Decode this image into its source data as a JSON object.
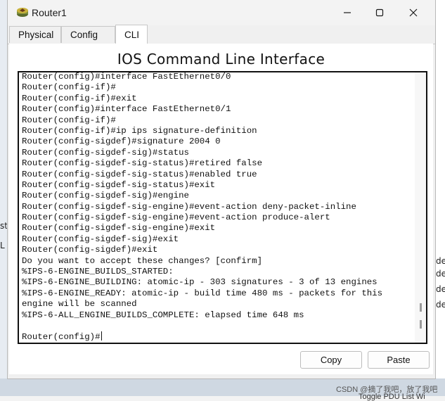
{
  "window": {
    "title": "Router1"
  },
  "tabs": [
    {
      "label": "Physical"
    },
    {
      "label": "Config"
    },
    {
      "label": "CLI"
    }
  ],
  "panel": {
    "heading": "IOS Command Line Interface"
  },
  "terminal": {
    "lines": [
      "Router(config)#interface FastEthernet0/0",
      "Router(config-if)#",
      "Router(config-if)#exit",
      "Router(config)#interface FastEthernet0/1",
      "Router(config-if)#",
      "Router(config-if)#ip ips signature-definition",
      "Router(config-sigdef)#signature 2004 0",
      "Router(config-sigdef-sig)#status",
      "Router(config-sigdef-sig-status)#retired false",
      "Router(config-sigdef-sig-status)#enabled true",
      "Router(config-sigdef-sig-status)#exit",
      "Router(config-sigdef-sig)#engine",
      "Router(config-sigdef-sig-engine)#event-action deny-packet-inline",
      "Router(config-sigdef-sig-engine)#event-action produce-alert",
      "Router(config-sigdef-sig-engine)#exit",
      "Router(config-sigdef-sig)#exit",
      "Router(config-sigdef)#exit",
      "Do you want to accept these changes? [confirm]",
      "%IPS-6-ENGINE_BUILDS_STARTED:",
      "%IPS-6-ENGINE_BUILDING: atomic-ip - 303 signatures - 3 of 13 engines",
      "%IPS-6-ENGINE_READY: atomic-ip - build time 480 ms - packets for this",
      "engine will be scanned",
      "%IPS-6-ALL_ENGINE_BUILDS_COMPLETE: elapsed time 648 ms",
      "",
      "Router(config)#"
    ]
  },
  "buttons": {
    "copy": "Copy",
    "paste": "Paste"
  },
  "background": {
    "right_fragments": [
      "de",
      "de",
      "de",
      "de"
    ],
    "left_fragments": [
      "st",
      "L"
    ],
    "watermark": "CSDN @摘了我吧，放了我吧",
    "bottom_fragment": "Toggle PDU List Wi"
  },
  "colors": {
    "window_bg": "#f0f0f0",
    "panel_bg": "#ffffff",
    "terminal_border": "#111111"
  }
}
